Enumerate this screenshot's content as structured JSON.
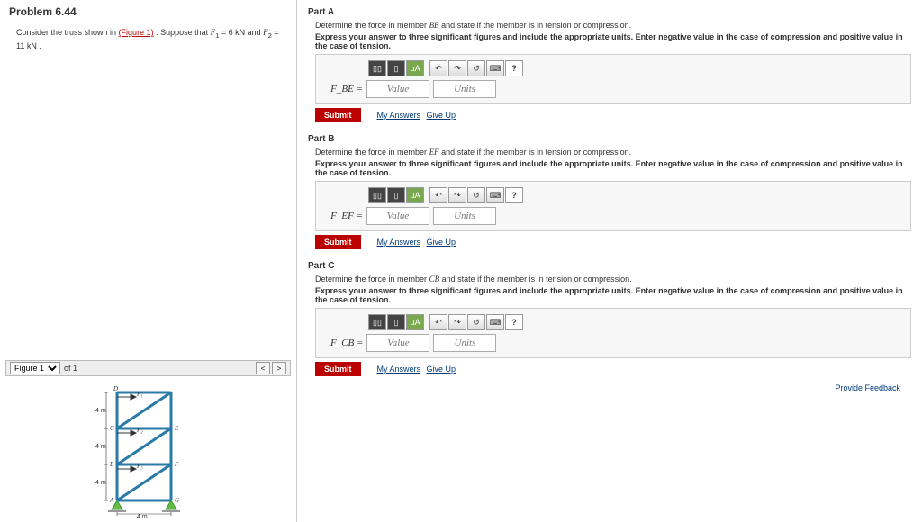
{
  "problem": {
    "title": "Problem 6.44",
    "text_prefix": "Consider the truss shown in ",
    "figure_link": "(Figure 1)",
    "text_mid": " . Suppose that ",
    "F1_label": "F",
    "F1_sub": "1",
    "F1_eq": " = 6 kN and ",
    "F2_label": "F",
    "F2_sub": "2",
    "F2_eq": " = 11 kN ."
  },
  "figure": {
    "selector_label": "Figure 1",
    "of_text": "of 1",
    "prev": "<",
    "next": ">",
    "dim_4m": "4 m",
    "labels": {
      "A": "A",
      "B": "B",
      "C": "C",
      "D": "D",
      "E": "E",
      "F": "F",
      "G": "G"
    },
    "forces": {
      "F1": "F₁",
      "F2": "F₂",
      "F3": "F₃"
    }
  },
  "parts": [
    {
      "title": "Part A",
      "desc_pre": "Determine the force in member ",
      "member": "BE",
      "desc_post": " and state if the member is in tension or compression.",
      "flabel": "F_BE ="
    },
    {
      "title": "Part B",
      "desc_pre": "Determine the force in member ",
      "member": "EF",
      "desc_post": " and state if the member is in tension or compression.",
      "flabel": "F_EF ="
    },
    {
      "title": "Part C",
      "desc_pre": "Determine the force in member ",
      "member": "CB",
      "desc_post": " and state if the member is in tension or compression.",
      "flabel": "F_CB ="
    }
  ],
  "common": {
    "express": "Express your answer to three significant figures and include the appropriate units. Enter negative value in the case of compression and positive value in the case of tension.",
    "value_placeholder": "Value",
    "units_placeholder": "Units",
    "submit": "Submit",
    "my_answers": "My Answers",
    "give_up": "Give Up",
    "mu_a": "µA",
    "undo": "↶",
    "redo": "↷",
    "reset": "↺",
    "kbd": "⌨",
    "help": "?",
    "tpl1": "▯▯",
    "tpl2": "▯"
  },
  "feedback": "Provide Feedback"
}
